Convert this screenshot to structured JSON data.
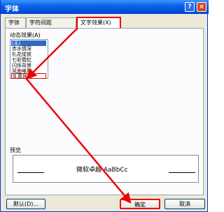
{
  "window": {
    "title": "字体"
  },
  "titlebar": {
    "help": "?",
    "close": "×"
  },
  "tabs": [
    "字体",
    "字符间距",
    "文字效果(X)"
  ],
  "effects": {
    "label": "动态效果(A)",
    "items": [
      "(无)",
      "赤水情深",
      "礼花绽放",
      "七彩霓虹",
      "闪烁背景",
      "风驰电掣",
      "乱真效幻"
    ]
  },
  "preview": {
    "label": "预览",
    "text": "微软卓越 AaBbCc"
  },
  "buttons": {
    "default": "默认(D)...",
    "ok": "确定",
    "cancel": "取消"
  }
}
